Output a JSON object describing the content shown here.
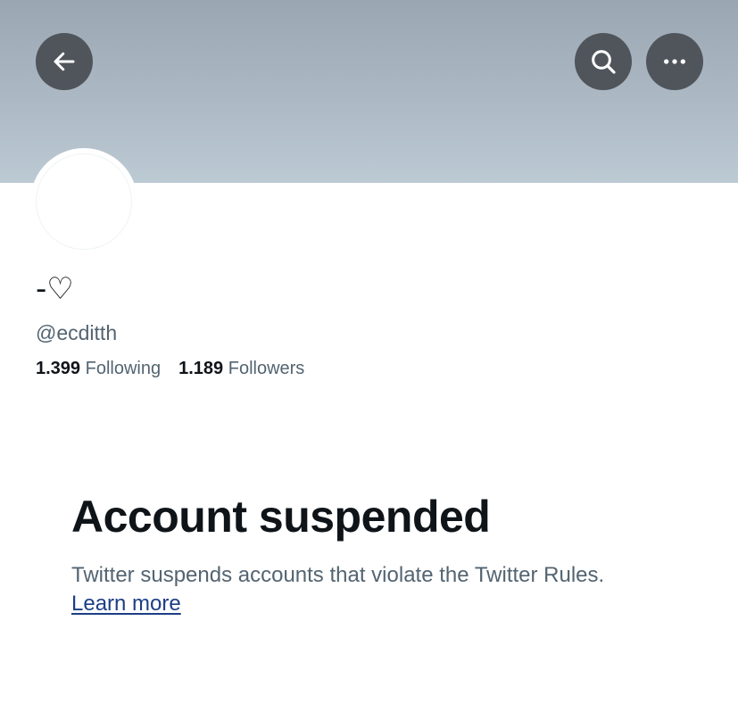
{
  "header": {
    "back_icon": "arrow-left-icon",
    "search_icon": "search-icon",
    "more_icon": "more-horizontal-icon"
  },
  "profile": {
    "display_name": "-♡",
    "handle": "@ecditth",
    "following_count": "1.399",
    "following_label": "Following",
    "followers_count": "1.189",
    "followers_label": "Followers"
  },
  "suspension": {
    "title": "Account suspended",
    "message": "Twitter suspends accounts that violate the Twitter Rules.",
    "link_label": "Learn more"
  },
  "colors": {
    "banner": "#a9b5c0",
    "button_bg": "#4f555b",
    "secondary_text": "#536471",
    "link": "#1d3e86"
  }
}
